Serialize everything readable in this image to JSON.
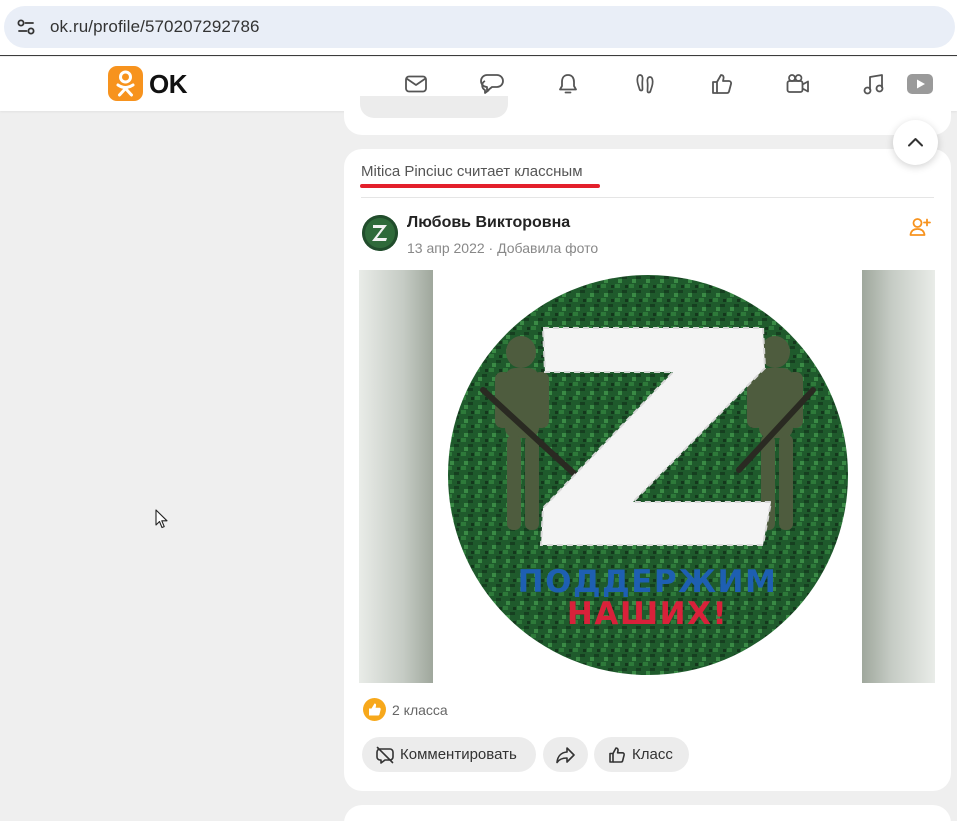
{
  "browser": {
    "url": "ok.ru/profile/570207292786"
  },
  "header": {
    "brand": "OK",
    "nav": [
      {
        "name": "messages-icon"
      },
      {
        "name": "discussions-icon"
      },
      {
        "name": "notifications-icon"
      },
      {
        "name": "guests-icon"
      },
      {
        "name": "likes-icon"
      },
      {
        "name": "video-call-icon"
      },
      {
        "name": "music-icon"
      },
      {
        "name": "video-icon"
      }
    ]
  },
  "post": {
    "activity": "Mitica Pinciuc считает классным",
    "author": "Любовь Викторовна",
    "date": "13 апр 2022",
    "meta_sep": "·",
    "action_text": "Добавила фото",
    "image_text_line1": "ПОДДЕРЖИМ",
    "image_text_line2": "НАШИХ!",
    "likes": "2 класса",
    "buttons": {
      "comment": "Комментировать",
      "like": "Класс"
    }
  },
  "colors": {
    "brand": "#f7931e",
    "accent_red": "#e3202b",
    "like": "#f7a81b"
  }
}
